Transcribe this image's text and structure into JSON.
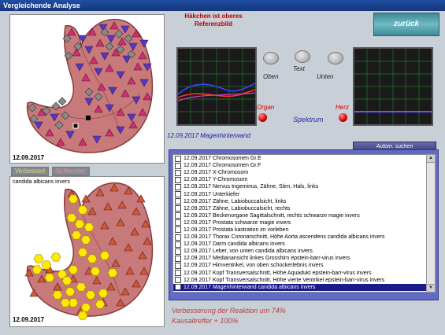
{
  "window": {
    "title": "Vergleichende Analyse"
  },
  "images": {
    "top_date": "12.09.2017",
    "bottom_date": "12.09.2017",
    "bottom_caption": "candida albicans invers"
  },
  "tabs": [
    {
      "label": "Verbessert"
    },
    {
      "label": "Schlechter"
    }
  ],
  "reference_text": "Häkchen ist oberes Referenzbild",
  "back_button": "zurück",
  "controls": {
    "oben": "Oben",
    "text": "Text",
    "unten": "Unten",
    "organ": "Organ",
    "spektrum": "Spektrum",
    "herz": "Herz"
  },
  "status_line": "12.09.2017  Magenhinterwand",
  "list_header": "Autom. suchen",
  "list": [
    {
      "text": "12.09.2017  Chromosomen Gr.E"
    },
    {
      "text": "12.09.2017  Chromosomen Gr.F"
    },
    {
      "text": "12.09.2017  X-Chromosom"
    },
    {
      "text": "12.09.2017  Y-Chromosom"
    },
    {
      "text": "12.09.2017  Nervus trigeminus, Zähne, Stirn, Hals, links"
    },
    {
      "text": "12.09.2017  Unterkiefer"
    },
    {
      "text": "12.09.2017  Zähne, Labiobuccalsicht, links"
    },
    {
      "text": "12.09.2017  Zähne, Labiobuccalsicht, rechts"
    },
    {
      "text": "12.09.2017  Beckenorgane Sagittalschnitt, rechts  schwarze magie invers"
    },
    {
      "text": "12.09.2017  Prostata  schwarze magie invers"
    },
    {
      "text": "12.09.2017  Prostata  kastration im vorleben"
    },
    {
      "text": "12.09.2017  Thorax Coronarschnitt, Höhe Aorta ascendens  candida albicans invers"
    },
    {
      "text": "12.09.2017  Darm  candida albicans invers"
    },
    {
      "text": "12.09.2017  Leber, von unten  candida albicans invers"
    },
    {
      "text": "12.09.2017  Medianansicht linkes Grosshirn  epstein-barr-virus invers"
    },
    {
      "text": "12.09.2017  Hirnventrikel, von oben  schockerlebnis invers"
    },
    {
      "text": "12.09.2017  Kopf Transversalschnitt, Höhe Aquadukt  epstein-barr-virus invers"
    },
    {
      "text": "12.09.2017  Kopf Transversalschnitt, Höhe vierte Ventrikel  epstein-barr-virus invers"
    },
    {
      "text": "12.09.2017  Magenhinterwand  candida albicans invers",
      "selected": true
    }
  ],
  "result": {
    "line1": "Verbesserung der Reaktion um 74%",
    "line2": "Kausaltreffer + 100%"
  },
  "colors": {
    "title_bar": "#1f4ea3",
    "list_frame": "#5f6bc6",
    "selected_row": "#1a1a8a",
    "result_text": "#b24040",
    "stomach": "#c96a6a"
  },
  "icons": [
    "stomach-image-top",
    "stomach-image-bottom",
    "scrollbar-up-icon",
    "scrollbar-down-icon"
  ]
}
